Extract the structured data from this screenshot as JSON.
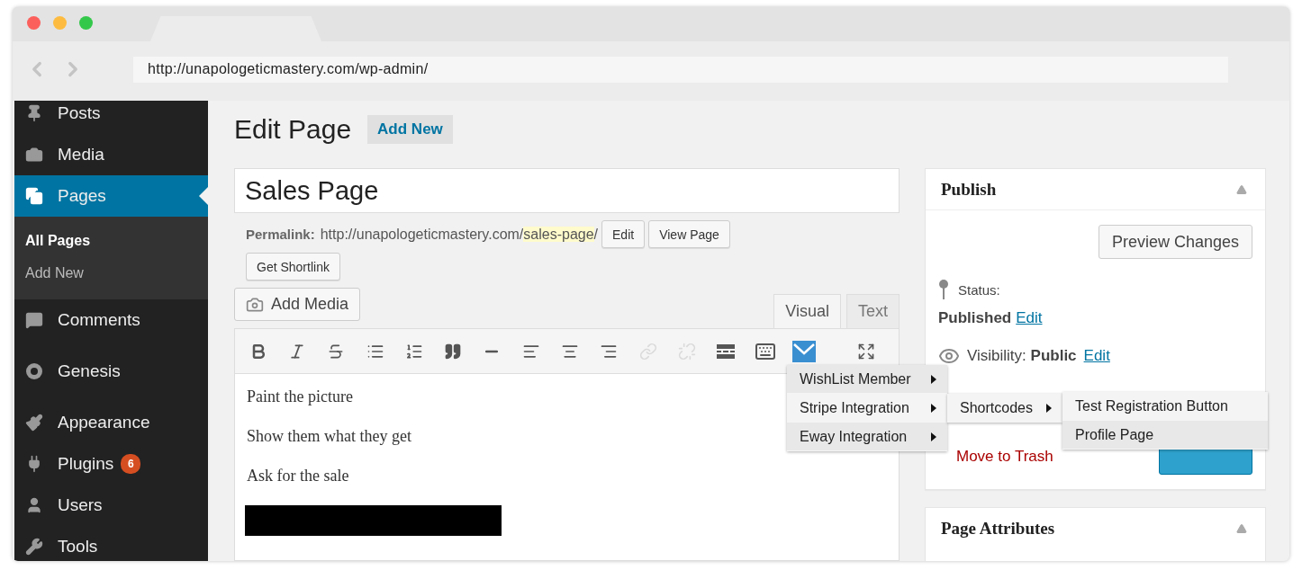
{
  "browser": {
    "url": "http://unapologeticmastery.com/wp-admin/"
  },
  "sidebar": {
    "items": [
      {
        "kind": "posts",
        "label": "Posts",
        "selected": false
      },
      {
        "kind": "media",
        "label": "Media",
        "selected": false
      },
      {
        "kind": "pages",
        "label": "Pages",
        "selected": true,
        "children": [
          {
            "label": "All Pages",
            "selected": true
          },
          {
            "label": "Add New",
            "selected": false
          }
        ]
      },
      {
        "kind": "comments",
        "label": "Comments",
        "selected": false
      },
      {
        "kind": "separator"
      },
      {
        "kind": "genesis",
        "label": "Genesis",
        "selected": false
      },
      {
        "kind": "separator"
      },
      {
        "kind": "appearance",
        "label": "Appearance",
        "selected": false
      },
      {
        "kind": "plugins",
        "label": "Plugins",
        "selected": false,
        "badge": "6"
      },
      {
        "kind": "users",
        "label": "Users",
        "selected": false
      },
      {
        "kind": "tools",
        "label": "Tools",
        "selected": false
      }
    ]
  },
  "header": {
    "title": "Edit Page",
    "add_new": "Add New"
  },
  "post_title": "Sales Page",
  "permalink": {
    "label": "Permalink:",
    "base": "http://unapologeticmastery.com/",
    "slug": "sales-page",
    "end": "/",
    "buttons": [
      "Edit",
      "View Page",
      "Get Shortlink"
    ]
  },
  "add_media": "Add Media",
  "editor_tabs": [
    {
      "label": "Visual",
      "selected": true
    },
    {
      "label": "Text",
      "selected": false
    }
  ],
  "toolbar": [
    {
      "kind": "bold",
      "disabled": false
    },
    {
      "kind": "italic",
      "disabled": false
    },
    {
      "kind": "strikethrough",
      "disabled": false
    },
    {
      "kind": "bullet-list",
      "disabled": false
    },
    {
      "kind": "numbered-list",
      "disabled": false
    },
    {
      "kind": "quote",
      "disabled": false
    },
    {
      "kind": "rule",
      "disabled": false
    },
    {
      "kind": "align-left",
      "disabled": false
    },
    {
      "kind": "align-center",
      "disabled": false
    },
    {
      "kind": "align-right",
      "disabled": false
    },
    {
      "kind": "link",
      "disabled": true
    },
    {
      "kind": "unlink",
      "disabled": true
    },
    {
      "kind": "more",
      "disabled": false
    },
    {
      "kind": "keyboard",
      "disabled": false
    },
    {
      "kind": "envelope",
      "disabled": false
    },
    {
      "kind": "fullscreen",
      "disabled": false
    }
  ],
  "content": [
    {
      "kind": "paragraph",
      "text": "Paint the picture"
    },
    {
      "kind": "paragraph",
      "text": "Show them what they get"
    },
    {
      "kind": "paragraph",
      "text": "Ask for the sale"
    },
    {
      "kind": "redaction"
    }
  ],
  "publish": {
    "title": "Publish",
    "preview": "Preview Changes",
    "status_label": "Status:",
    "status_value": "Published",
    "status_edit": "Edit",
    "visibility": "Visibility: **Public**",
    "visibility_edit": "Edit",
    "trash": "Move to Trash"
  },
  "page_attributes": {
    "title": "Page Attributes"
  },
  "menus": [
    [
      {
        "label": "WishList Member",
        "selected": false
      },
      {
        "label": "Stripe Integration",
        "selected": true
      },
      {
        "label": "Eway Integration",
        "selected": false
      }
    ],
    [
      {
        "label": "Shortcodes",
        "selected": true
      }
    ],
    [
      {
        "label": "Test Registration Button",
        "selected": true
      },
      {
        "label": "Profile Page",
        "selected": false
      }
    ]
  ]
}
